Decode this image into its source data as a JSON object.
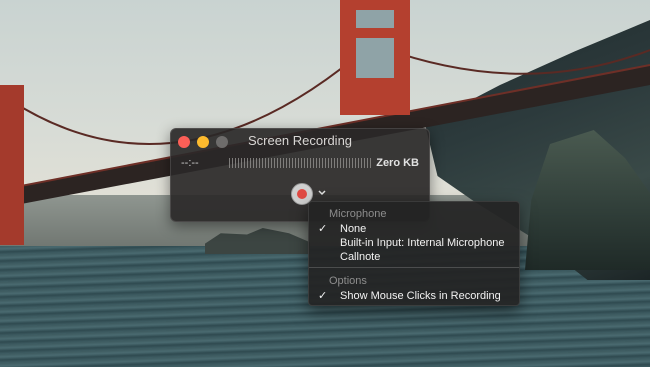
{
  "window": {
    "title": "Screen Recording",
    "elapsed_time": "--:--",
    "file_size": "Zero KB"
  },
  "menu": {
    "microphone_heading": "Microphone",
    "microphone_items": [
      {
        "label": "None",
        "checked": true,
        "check": "✓"
      },
      {
        "label": "Built-in Input: Internal Microphone",
        "checked": false,
        "check": ""
      },
      {
        "label": "Callnote",
        "checked": false,
        "check": ""
      }
    ],
    "options_heading": "Options",
    "option_items": [
      {
        "label": "Show Mouse Clicks in Recording",
        "checked": true,
        "check": "✓"
      }
    ]
  },
  "icons": {
    "close": "close-icon",
    "minimize": "minimize-icon",
    "zoom": "zoom-icon",
    "record": "record-icon",
    "options": "chevron-down-icon"
  },
  "colors": {
    "close": "#fc5f57",
    "minimize": "#fdbb2e",
    "record": "#e04a43"
  }
}
